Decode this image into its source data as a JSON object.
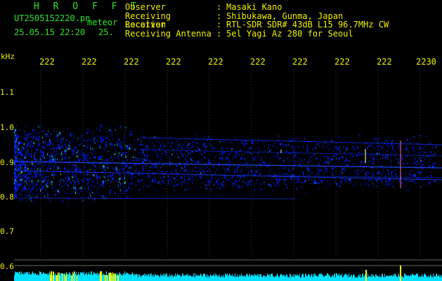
{
  "header": {
    "title": "H R O F F T",
    "filename": "UT2505152220.pn",
    "label": "meteor",
    "datetime": "25.05.15 22:20",
    "datetime_cut": "25."
  },
  "info": [
    {
      "label": "Observer",
      "value": "Masaki Kano"
    },
    {
      "label": "Receiving Location",
      "value": "Shibukawa, Gunma, Japan"
    },
    {
      "label": "Receiver",
      "value": "RTL-SDR SDR# 43dB L15 96.7MHz CW"
    },
    {
      "label": "Receiving Antenna",
      "value": "5el Yagi Az 280 for Seoul"
    }
  ],
  "axes": {
    "y_unit": "kHz",
    "x_ticks": [
      "222",
      "222",
      "222",
      "222",
      "222",
      "222",
      "222",
      "222",
      "222",
      "2230"
    ],
    "y_ticks": [
      "1.1",
      "1.0",
      "0.9",
      "0.8",
      "0.7",
      "0.6"
    ]
  },
  "colors": {
    "title": "#2ee62e",
    "text": "#f0f000",
    "signal_strong": "#ffffff",
    "signal_mid": "#00c8ff",
    "signal_weak": "#0020ff",
    "level_bar": "#00e0ff",
    "level_peak": "#ffff00"
  }
}
